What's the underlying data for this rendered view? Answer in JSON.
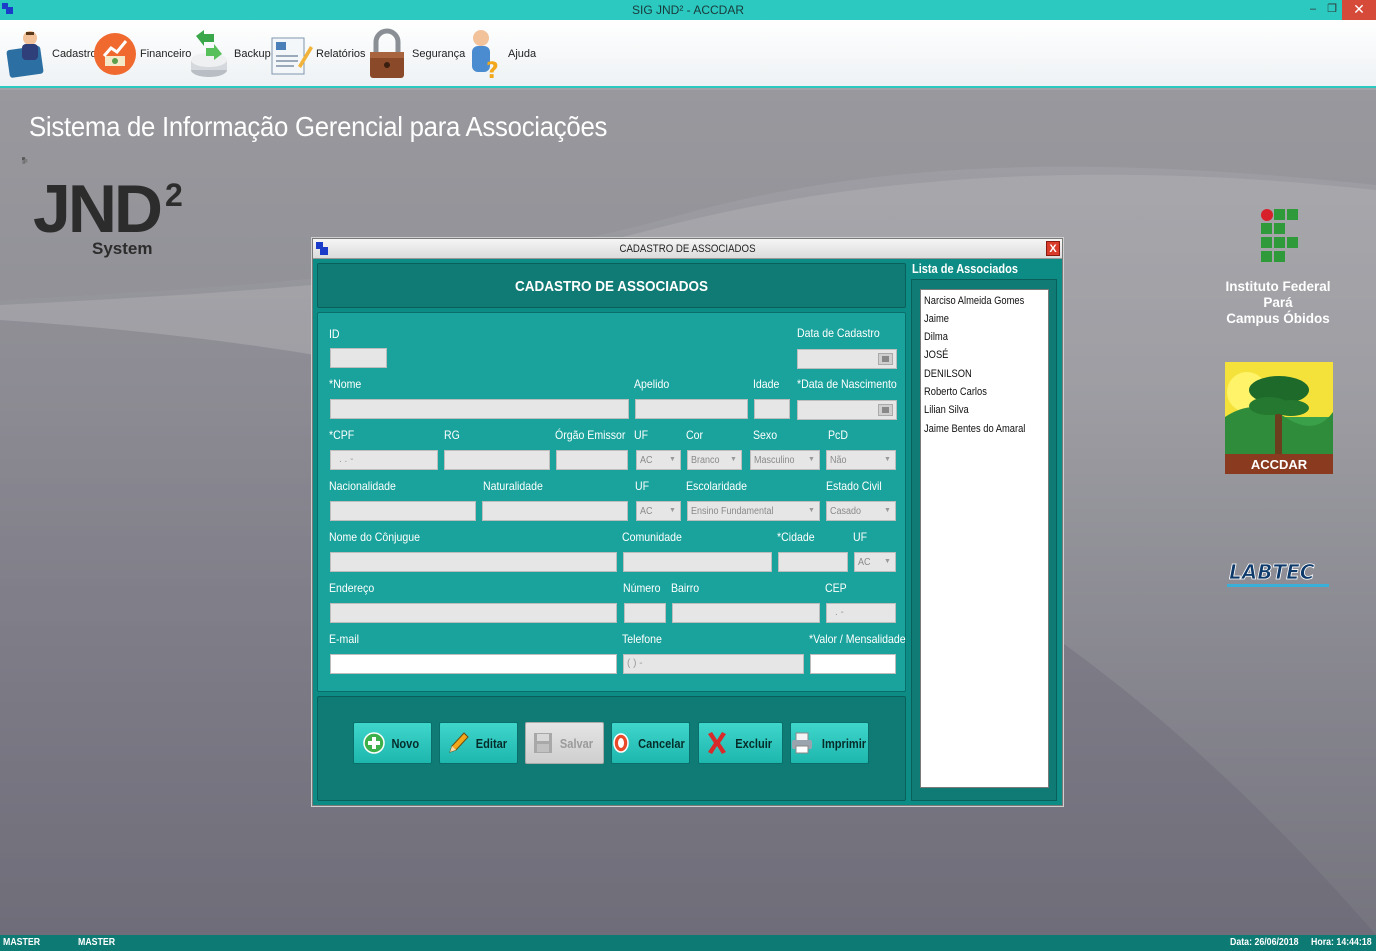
{
  "window": {
    "title": "SIG JND² - ACCDAR",
    "minimize": "‒",
    "maximize": "❐",
    "close": "✕"
  },
  "toolbar": {
    "items": [
      {
        "label": "Cadastro",
        "icon": "user-folder-icon"
      },
      {
        "label": "Financeiro",
        "icon": "money-chart-icon"
      },
      {
        "label": "Backup",
        "icon": "backup-drive-icon"
      },
      {
        "label": "Relatórios",
        "icon": "report-icon"
      },
      {
        "label": "Segurança",
        "icon": "padlock-icon"
      },
      {
        "label": "Ajuda",
        "icon": "help-user-icon"
      }
    ]
  },
  "background": {
    "headline": "Sistema de Informação Gerencial para Associações",
    "logo": {
      "main": "JND",
      "sup": "2",
      "sub": "System"
    },
    "institution": [
      "Instituto Federal",
      "Pará",
      "Campus Óbidos"
    ],
    "accdar_logo_text": "ACCDAR",
    "labtec_logo_text": "LABTEC"
  },
  "dialog": {
    "title": "CADASTRO DE ASSOCIADOS",
    "close": "X",
    "heading": "CADASTRO DE ASSOCIADOS",
    "labels": {
      "id": "ID",
      "data_cadastro": "Data de Cadastro",
      "nome": "*Nome",
      "apelido": "Apelido",
      "idade": "Idade",
      "data_nascimento": "*Data de Nascimento",
      "cpf": "*CPF",
      "rg": "RG",
      "orgao_emissor": "Órgão Emissor",
      "uf1": "UF",
      "cor": "Cor",
      "sexo": "Sexo",
      "pcd": "PcD",
      "nacionalidade": "Nacionalidade",
      "naturalidade": "Naturalidade",
      "uf2": "UF",
      "escolaridade": "Escolaridade",
      "estado_civil": "Estado Civil",
      "conjugue": "Nome do Cônjugue",
      "comunidade": "Comunidade",
      "cidade": "*Cidade",
      "uf3": "UF",
      "endereco": "Endereço",
      "numero": "Número",
      "bairro": "Bairro",
      "cep": "CEP",
      "email": "E-mail",
      "telefone": "Telefone",
      "valor": "*Valor / Mensalidade"
    },
    "placeholders": {
      "cpf": ".   .   -",
      "cep": ".   -",
      "telefone": "(   )     -"
    },
    "selects": {
      "uf1": "AC",
      "cor": "Branco",
      "sexo": "Masculino",
      "pcd": "Não",
      "uf2": "AC",
      "escolaridade": "Ensino Fundamental",
      "estado_civil": "Casado",
      "uf3": "AC"
    },
    "buttons": {
      "novo": "Novo",
      "editar": "Editar",
      "salvar": "Salvar",
      "cancelar": "Cancelar",
      "excluir": "Excluir",
      "imprimir": "Imprimir"
    },
    "list": {
      "title": "Lista de Associados",
      "items": [
        "Narciso Almeida Gomes",
        "Jaime",
        "Dilma",
        "JOSÉ",
        "DENILSON",
        "Roberto Carlos",
        "Lilian Silva",
        "Jaime Bentes do Amaral"
      ]
    }
  },
  "status": {
    "user1": "MASTER",
    "user2": "MASTER",
    "date": "Data: 26/06/2018",
    "time": "Hora: 14:44:18"
  },
  "colors": {
    "accent": "#2bc9c0",
    "dialog_bg": "#1aa39c",
    "status_bar": "#0d7a73"
  }
}
